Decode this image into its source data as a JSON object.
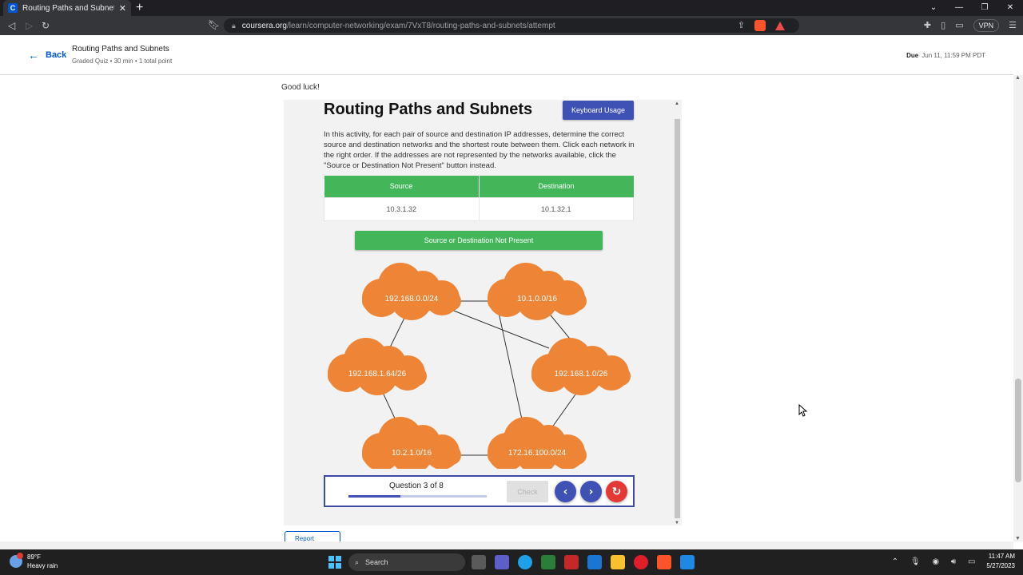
{
  "browser": {
    "tab_title": "Routing Paths and Subnets | Cou",
    "tab_favicon": "C",
    "url_host": "coursera.org",
    "url_path": "/learn/computer-networking/exam/7VxT8/routing-paths-and-subnets/attempt",
    "vpn_label": "VPN"
  },
  "header": {
    "back_label": "Back",
    "title": "Routing Paths and Subnets",
    "meta": "Graded Quiz • 30 min • 1 total point",
    "due_label": "Due",
    "due_value": "Jun 11, 11:59 PM PDT"
  },
  "page": {
    "intro": "Good luck!",
    "report_label": "Report"
  },
  "activity": {
    "title": "Routing Paths and Subnets",
    "keyboard_button": "Keyboard Usage",
    "instructions": "In this activity, for each pair of source and destination IP addresses, determine the correct source and destination networks and the shortest route between them. Click each network in the right order. If the addresses are not represented by the networks available, click the \"Source or Destination Not Present\" button instead.",
    "table": {
      "headers": [
        "Source",
        "Destination"
      ],
      "values": [
        "10.3.1.32",
        "10.1.32.1"
      ]
    },
    "not_present_button": "Source or Destination Not Present",
    "cloud_color": "#ed8436",
    "networks": [
      "192.168.0.0/24",
      "10.1.0.0/16",
      "192.168.1.64/26",
      "192.168.1.0/26",
      "10.2.1.0/16",
      "172.16.100.0/24"
    ],
    "controls": {
      "question_label": "Question 3 of 8",
      "progress": 0.375,
      "check_label": "Check",
      "prev_icon": "chevron-left-icon",
      "next_icon": "chevron-right-icon",
      "reset_icon": "refresh-icon"
    }
  },
  "taskbar": {
    "temperature": "89°F",
    "weather": "Heavy rain",
    "search_label": "Search",
    "time": "11:47 AM",
    "date": "5/27/2023"
  }
}
